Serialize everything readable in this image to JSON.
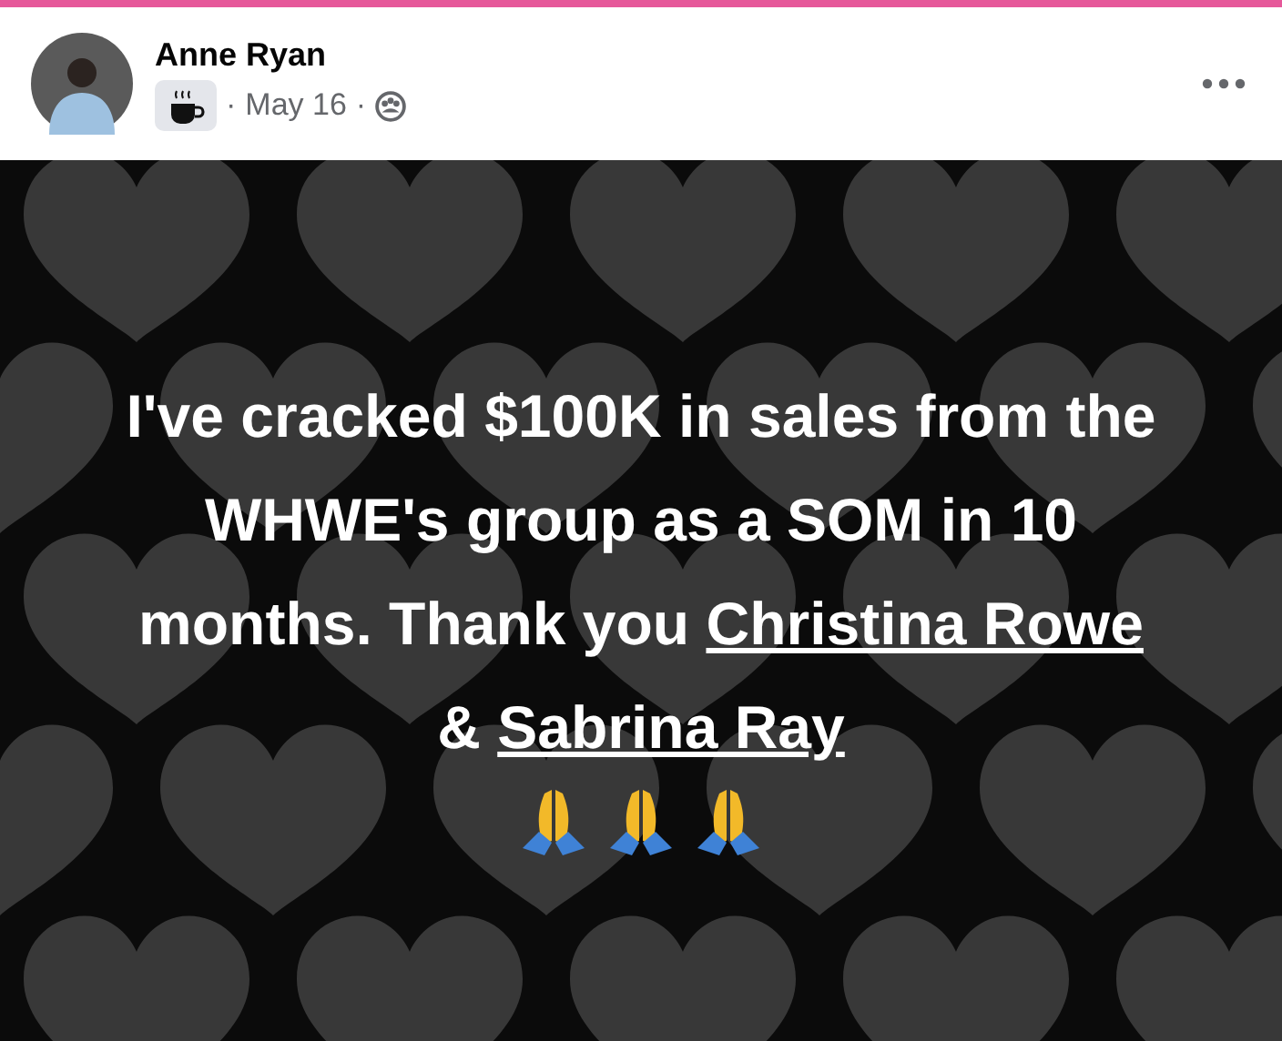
{
  "post": {
    "author": "Anne Ryan",
    "dot_before": "·",
    "date": "May 16",
    "dot_after": "·"
  },
  "message": [
    {
      "kind": "text",
      "text": "I've cracked $100K in sales from the WHWE's group as a SOM in 10 months. Thank you "
    },
    {
      "kind": "link",
      "text": "Christina Rowe"
    },
    {
      "kind": "text",
      "text": " & "
    },
    {
      "kind": "link",
      "text": "Sabrina Ray"
    }
  ]
}
